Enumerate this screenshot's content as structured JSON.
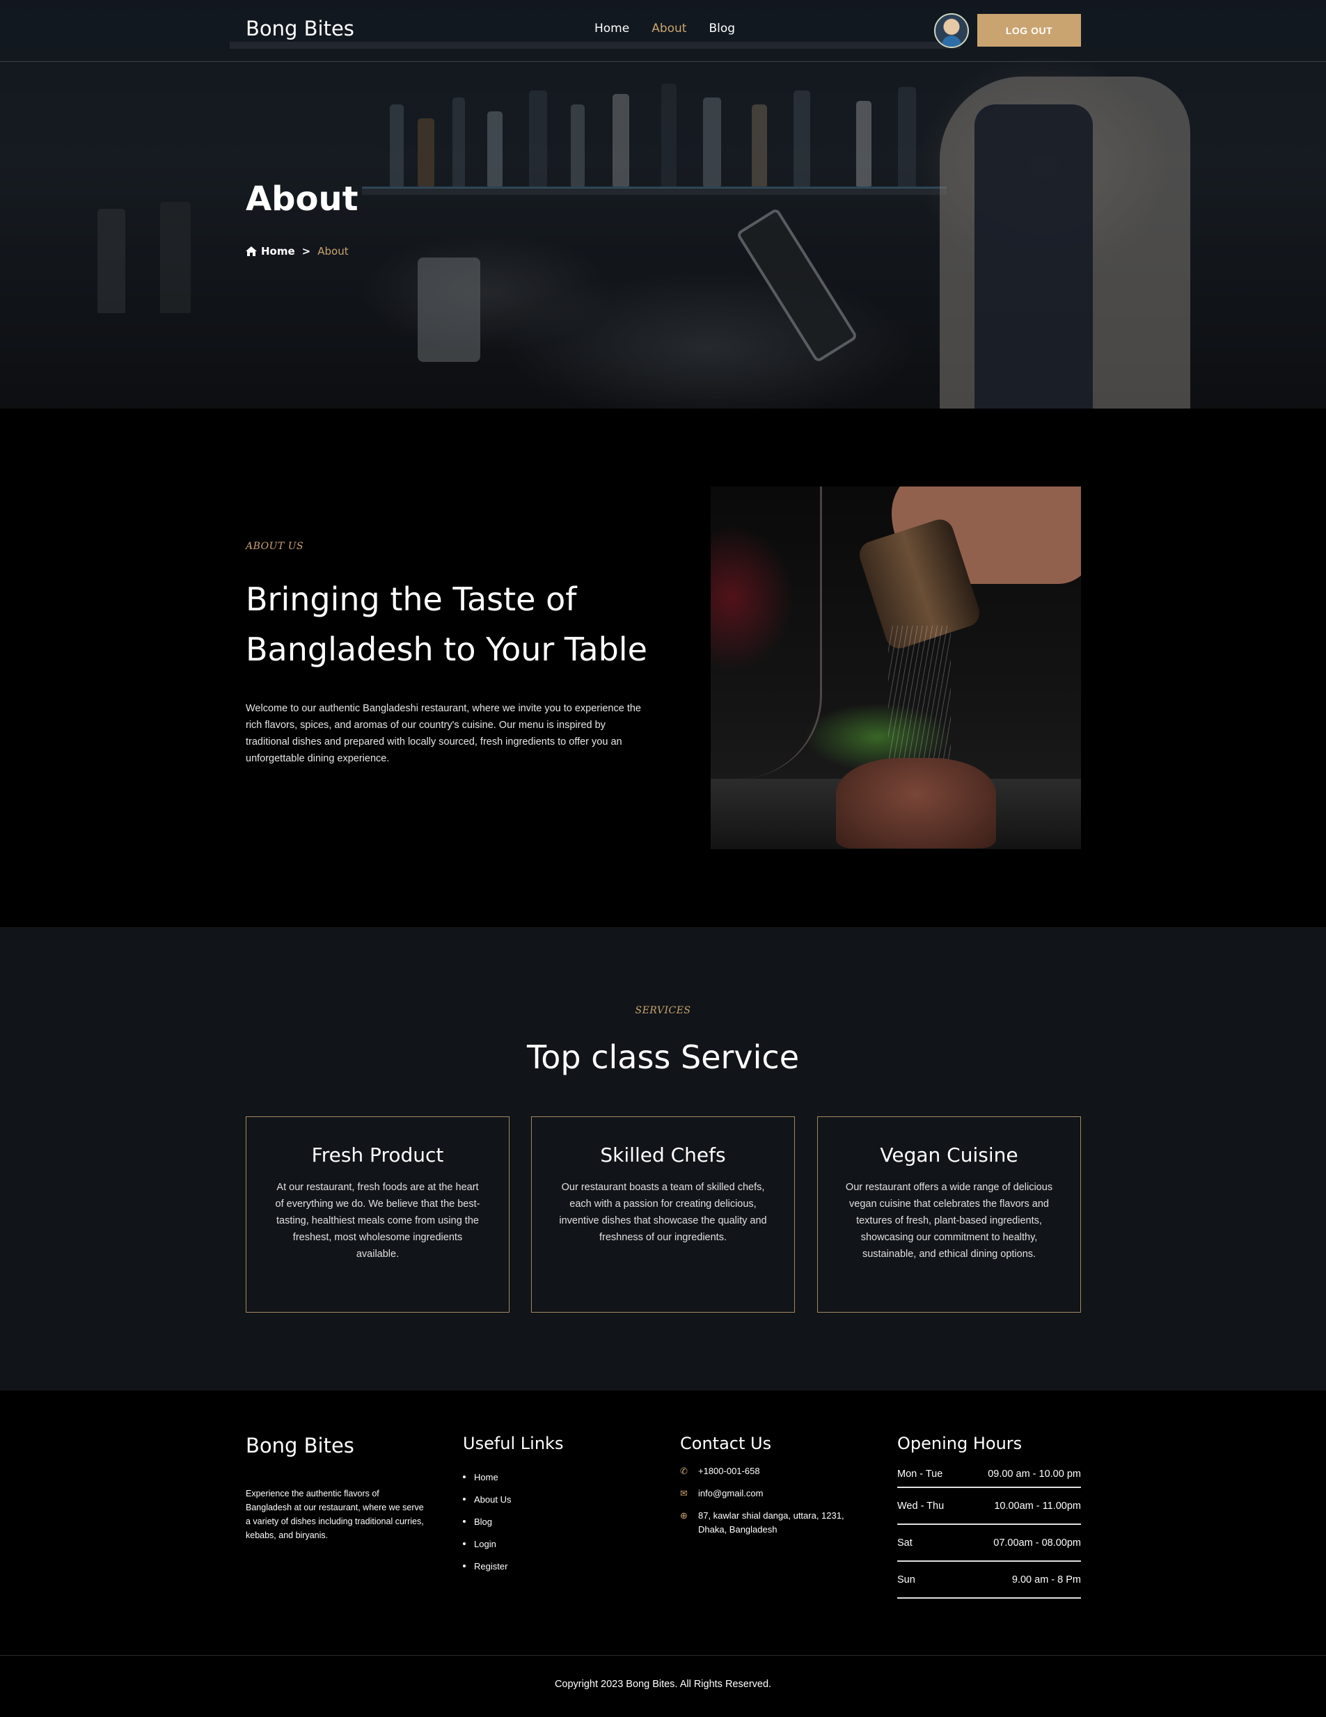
{
  "header": {
    "brand": "Bong Bites",
    "nav": [
      {
        "label": "Home",
        "active": false
      },
      {
        "label": "About",
        "active": true
      },
      {
        "label": "Blog",
        "active": false
      }
    ],
    "logout_label": "LOG OUT"
  },
  "hero": {
    "title": "About",
    "breadcrumb": {
      "home": "Home",
      "separator": ">",
      "current": "About"
    }
  },
  "about": {
    "eyebrow": "ABOUT US",
    "heading": "Bringing the Taste of Bangladesh to Your Table",
    "body": "Welcome to our authentic Bangladeshi restaurant, where we invite you to experience the rich flavors, spices, and aromas of our country's cuisine. Our menu is inspired by traditional dishes and prepared with locally sourced, fresh ingredients to offer you an unforgettable dining experience."
  },
  "services": {
    "eyebrow": "SERVICES",
    "heading": "Top class Service",
    "cards": [
      {
        "title": "Fresh Product",
        "body": "At our restaurant, fresh foods are at the heart of everything we do. We believe that the best-tasting, healthiest meals come from using the freshest, most wholesome ingredients available."
      },
      {
        "title": "Skilled Chefs",
        "body": "Our restaurant boasts a team of skilled chefs, each with a passion for creating delicious, inventive dishes that showcase the quality and freshness of our ingredients."
      },
      {
        "title": "Vegan Cuisine",
        "body": "Our restaurant offers a wide range of delicious vegan cuisine that celebrates the flavors and textures of fresh, plant-based ingredients, showcasing our commitment to healthy, sustainable, and ethical dining options."
      }
    ]
  },
  "footer": {
    "brand": "Bong Bites",
    "description": "Experience the authentic flavors of Bangladesh at our restaurant, where we serve a variety of dishes including traditional curries, kebabs, and biryanis.",
    "links_title": "Useful Links",
    "links": [
      "Home",
      "About Us",
      "Blog",
      "Login",
      "Register"
    ],
    "contact_title": "Contact Us",
    "contact": {
      "phone": "+1800-001-658",
      "email": "info@gmail.com",
      "address": "87, kawlar shial danga, uttara, 1231, Dhaka, Bangladesh"
    },
    "hours_title": "Opening Hours",
    "hours": [
      {
        "days": "Mon - Tue",
        "time": "09.00 am - 10.00 pm"
      },
      {
        "days": "Wed - Thu",
        "time": "10.00am - 11.00pm"
      },
      {
        "days": "Sat",
        "time": "07.00am - 08.00pm"
      },
      {
        "days": "Sun",
        "time": "9.00 am - 8 Pm"
      }
    ],
    "copyright": "Copyright 2023 Bong Bites. All Rights Reserved."
  },
  "colors": {
    "accent": "#c9a471",
    "background": "#000000",
    "section_alt": "#111418"
  }
}
